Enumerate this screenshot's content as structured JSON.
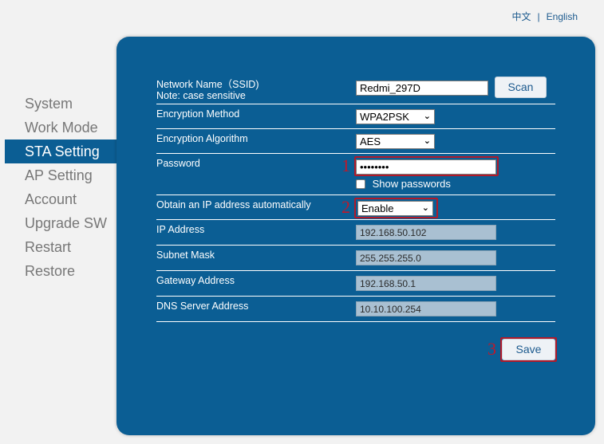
{
  "lang": {
    "chinese": "中文",
    "separator": "|",
    "english": "English"
  },
  "sidebar": {
    "items": [
      {
        "label": "System",
        "active": false
      },
      {
        "label": "Work Mode",
        "active": false
      },
      {
        "label": "STA Setting",
        "active": true
      },
      {
        "label": "AP Setting",
        "active": false
      },
      {
        "label": "Account",
        "active": false
      },
      {
        "label": "Upgrade SW",
        "active": false
      },
      {
        "label": "Restart",
        "active": false
      },
      {
        "label": "Restore",
        "active": false
      }
    ]
  },
  "form": {
    "ssid": {
      "label": "Network Name（SSID)",
      "note": "Note: case sensitive",
      "value": "Redmi_297D",
      "scan_label": "Scan"
    },
    "encryption_method": {
      "label": "Encryption Method",
      "value": "WPA2PSK"
    },
    "encryption_algorithm": {
      "label": "Encryption Algorithm",
      "value": "AES"
    },
    "password": {
      "label": "Password",
      "value": "••••••••",
      "show_label": "Show passwords"
    },
    "dhcp": {
      "label": "Obtain an IP address automatically",
      "value": "Enable"
    },
    "ip_address": {
      "label": "IP Address",
      "value": "192.168.50.102"
    },
    "subnet_mask": {
      "label": "Subnet Mask",
      "value": "255.255.255.0"
    },
    "gateway": {
      "label": "Gateway Address",
      "value": "192.168.50.1"
    },
    "dns": {
      "label": "DNS Server Address",
      "value": "10.10.100.254"
    },
    "save_label": "Save"
  },
  "annotations": {
    "step1": "1",
    "step2": "2",
    "step3": "3"
  },
  "colors": {
    "panel": "#0b5e94",
    "accent": "#1c5a8e",
    "highlight": "#b01a2a",
    "background": "#f2f2f2"
  }
}
